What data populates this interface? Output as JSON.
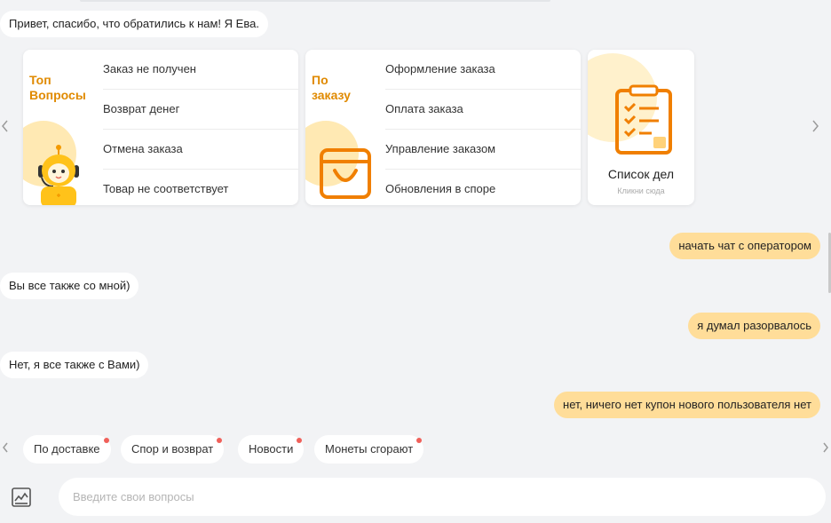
{
  "messages": {
    "greeting": "Привет, спасибо, что обратились к нам! Я Ева.",
    "user1": "начать чат с оператором",
    "bot1": "Вы все также со мной)",
    "user2": "я думал разорвалось",
    "bot2": "Нет, я все также с Вами)",
    "user3": "нет, ничего нет купон нового пользователя нет"
  },
  "cards": {
    "top": {
      "title_line1": "Топ",
      "title_line2": "Вопросы",
      "items": [
        "Заказ не получен",
        "Возврат денег",
        "Отмена заказа",
        "Товар не соответствует"
      ]
    },
    "order": {
      "title_line1": "По",
      "title_line2": "заказу",
      "items": [
        "Оформление заказа",
        "Оплата заказа",
        "Управление заказом",
        "Обновления в споре"
      ]
    },
    "todo": {
      "label": "Список дел",
      "sublabel": "Кликни сюда"
    }
  },
  "chips": [
    "По доставке",
    "Спор и возврат",
    "Новости",
    "Монеты сгорают"
  ],
  "input": {
    "placeholder": "Введите свои вопросы"
  },
  "icons": {
    "carousel_prev": "chevron-left-icon",
    "carousel_next": "chevron-right-icon",
    "chips_prev": "chevron-left-icon",
    "chips_next": "chevron-right-icon",
    "image_upload": "image-chart-icon"
  },
  "colors": {
    "accent": "#e08a00",
    "user_bubble": "#ffdd99",
    "badge": "#f0605a",
    "background": "#f2f3f5"
  }
}
